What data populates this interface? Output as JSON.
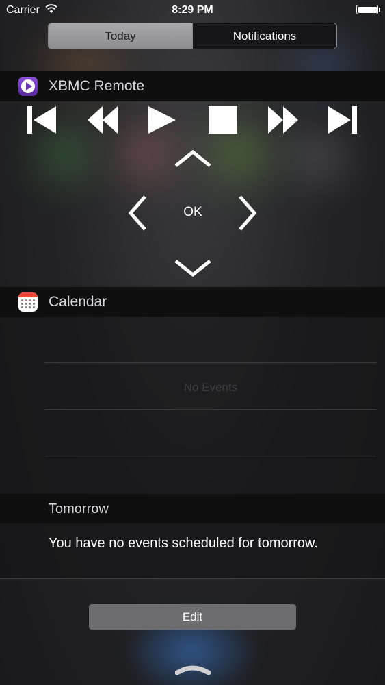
{
  "status_bar": {
    "carrier": "Carrier",
    "time": "8:29 PM",
    "battery_level": 1.0
  },
  "segmented_control": {
    "today_label": "Today",
    "notifications_label": "Notifications",
    "selected": "Today"
  },
  "xbmc_widget": {
    "title": "XBMC Remote",
    "icon": "xbmc-app-icon",
    "transport_controls": [
      "skip-previous-icon",
      "rewind-icon",
      "play-icon",
      "stop-icon",
      "fast-forward-icon",
      "skip-next-icon"
    ],
    "dpad": {
      "up": "chevron-up-icon",
      "left": "chevron-left-icon",
      "ok_label": "OK",
      "right": "chevron-right-icon",
      "down": "chevron-down-icon"
    }
  },
  "calendar_widget": {
    "title": "Calendar",
    "icon": "calendar-app-icon",
    "no_events_text": "No Events",
    "tomorrow_header": "Tomorrow",
    "tomorrow_text": "You have no events scheduled for tomorrow."
  },
  "footer": {
    "edit_label": "Edit",
    "grabber_icon": "grabber-handle-icon"
  },
  "colors": {
    "header_bg": "#0f0f10",
    "segment_active": "#9b9b9d",
    "edit_button": "#6d6d70",
    "calendar_red": "#e64b3c",
    "xbmc_purple": "#6b35b5"
  }
}
